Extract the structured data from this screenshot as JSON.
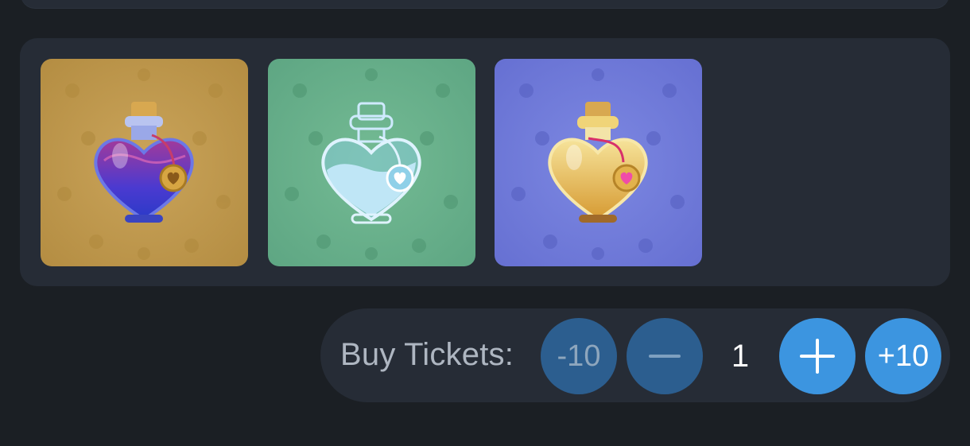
{
  "items": [
    {
      "icon": "heart-potion-purple-icon",
      "background": "#c29a4f"
    },
    {
      "icon": "heart-potion-outline-icon",
      "background": "#6ab08c"
    },
    {
      "icon": "heart-potion-gold-icon",
      "background": "#6f78d6"
    }
  ],
  "buy": {
    "label": "Buy Tickets:",
    "minus10_label": "-10",
    "plus10_label": "+10",
    "quantity": "1",
    "minus_icon": "minus-icon",
    "plus_icon": "plus-icon"
  },
  "colors": {
    "page_bg": "#1b1f24",
    "panel_bg": "#262c36",
    "button_active": "#3c95e0",
    "button_disabled": "#2c5e8f"
  }
}
